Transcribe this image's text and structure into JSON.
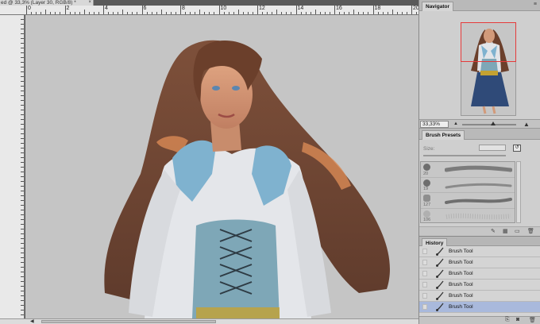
{
  "document": {
    "tab_title": "ed @ 33,3% (Layer 30, RGB/8) *",
    "close_glyph": "×"
  },
  "ruler": {
    "marks": [
      "0",
      "2",
      "4",
      "6",
      "8",
      "10",
      "12",
      "14",
      "16",
      "18",
      "20"
    ]
  },
  "navigator": {
    "tab_label": "Navigator",
    "menu_icon": "panel-menu-icon",
    "zoom_value": "33,33%",
    "zoom_out_icon": "zoom-out-mountain-icon",
    "zoom_in_icon": "zoom-in-mountain-icon",
    "frame_color": "#e53b3b"
  },
  "brush_presets": {
    "tab_label": "Brush Presets",
    "size_label": "Size:",
    "items": [
      {
        "size": "20"
      },
      {
        "size": "19"
      },
      {
        "size": "127"
      },
      {
        "size": "106"
      }
    ]
  },
  "history": {
    "tab_label": "History",
    "items": [
      {
        "label": "Brush Tool",
        "selected": false
      },
      {
        "label": "Brush Tool",
        "selected": false
      },
      {
        "label": "Brush Tool",
        "selected": false
      },
      {
        "label": "Brush Tool",
        "selected": false
      },
      {
        "label": "Brush Tool",
        "selected": false
      },
      {
        "label": "Brush Tool",
        "selected": true
      }
    ],
    "selected_color": "#a9b9dc"
  },
  "colors": {
    "canvas_bg": "#c5c5c5",
    "panel_bg": "#d0d0d0"
  }
}
